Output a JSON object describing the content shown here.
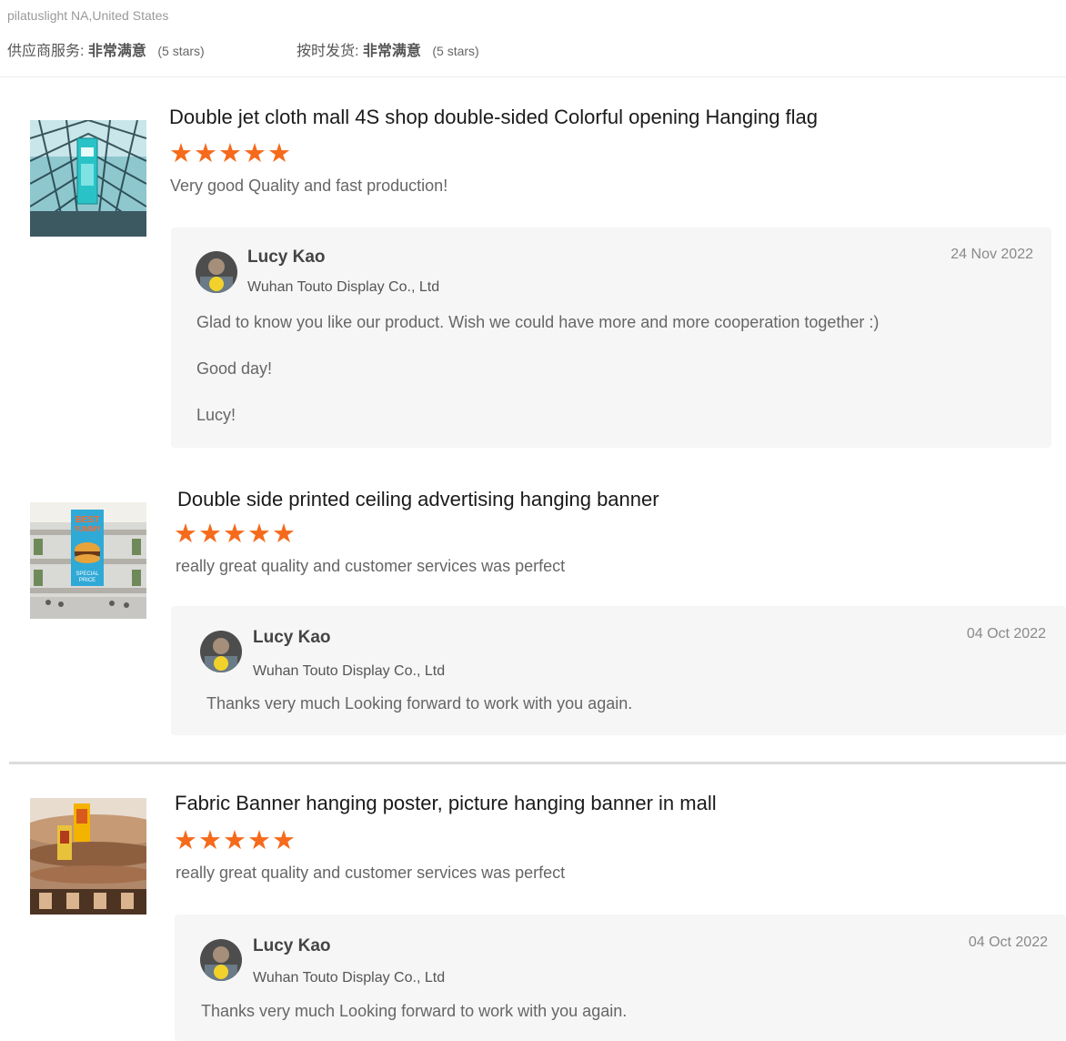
{
  "header": {
    "buyer_location": "pilatuslight NA,United States",
    "supplier_service": {
      "label": "供应商服务:",
      "value": "非常满意",
      "stars": "(5 stars)"
    },
    "on_time_shipment": {
      "label": "按时发货:",
      "value": "非常满意",
      "stars": "(5 stars)"
    }
  },
  "reviews": [
    {
      "title": "Double jet cloth mall 4S shop double-sided Colorful opening Hanging flag",
      "rating": 5,
      "stars": "★★★★★",
      "comment": "Very good Quality and fast production!",
      "reply": {
        "name": "Lucy Kao",
        "company": "Wuhan Touto Display Co., Ltd",
        "date": "24 Nov 2022",
        "lines": [
          "Glad to know you like our product.  Wish we could have more and more cooperation together :)",
          "Good day!",
          "Lucy!"
        ]
      }
    },
    {
      "title": "Double side printed ceiling advertising hanging banner",
      "rating": 5,
      "stars": "★★★★★",
      "comment": "really great quality and customer services was perfect",
      "thumb_text": {
        "line1": "BEST",
        "line2": "YUMMY",
        "line3": "SPECIAL",
        "line4": "PRICE"
      },
      "reply": {
        "name": "Lucy Kao",
        "company": "Wuhan Touto Display Co., Ltd",
        "date": "04 Oct 2022",
        "lines": [
          "Thanks very much Looking forward to work with you again."
        ]
      }
    },
    {
      "title": "Fabric Banner hanging poster, picture hanging banner in mall",
      "rating": 5,
      "stars": "★★★★★",
      "comment": "really great quality and customer services was perfect",
      "reply": {
        "name": "Lucy Kao",
        "company": "Wuhan Touto Display Co., Ltd",
        "date": "04 Oct 2022",
        "lines": [
          "Thanks very much Looking forward to work with you again."
        ]
      }
    }
  ]
}
